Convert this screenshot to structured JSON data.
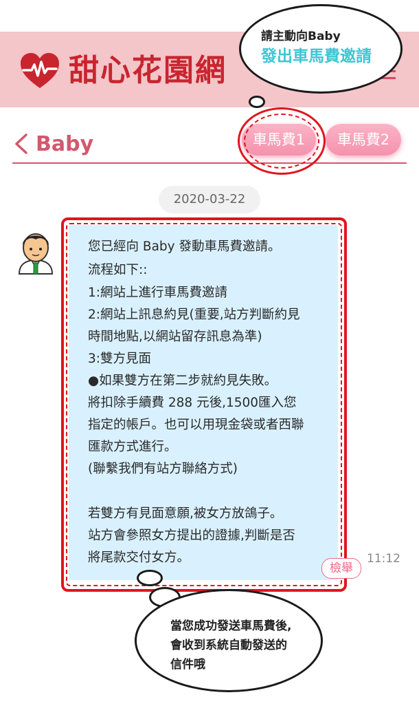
{
  "header": {
    "logo_text": "甜心花園網"
  },
  "nav": {
    "title": "Baby",
    "fee_buttons": [
      "車馬費1",
      "車馬費2"
    ]
  },
  "callouts": {
    "top": [
      "請主動向Baby",
      "發出車馬費邀請"
    ],
    "bottom": [
      "當您成功發送車馬費後,",
      "會收到系統自動發送的",
      "信件哦"
    ]
  },
  "chat": {
    "date": "2020-03-22",
    "message_lines": [
      "您已經向 Baby 發動車馬費邀請。",
      "流程如下::",
      "1:網站上進行車馬費邀請",
      "2:網站上訊息約見(重要,站方判斷約見",
      "時間地點,以網站留存訊息為準)",
      "3:雙方見面",
      "●如果雙方在第二步就約見失敗。",
      "將扣除手續費 288 元後,1500匯入您",
      "指定的帳戶。也可以用現金袋或者西聯",
      "匯款方式進行。",
      "(聯繫我們有站方聯絡方式)",
      "",
      "若雙方有見面意願,被女方放鴿子。",
      "站方會參照女方提出的證據,判斷是否",
      "將尾款交付女方。"
    ],
    "time": "11:12",
    "report_label": "檢舉"
  },
  "colors": {
    "brand_red": "#c8252f",
    "header_pink": "#f4c5c9",
    "bubble_blue": "#d9f1fe",
    "highlight_red": "#e0141e",
    "callout_cyan": "#3cc7d3"
  }
}
